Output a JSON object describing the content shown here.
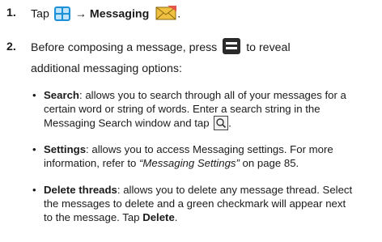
{
  "step1": {
    "number": "1.",
    "text_before": "Tap",
    "arrow": "→",
    "bold": "Messaging",
    "end": "."
  },
  "step2": {
    "number": "2.",
    "text_before": "Before composing a message, press",
    "text_after": "to reveal",
    "line2": "additional messaging options:"
  },
  "bullets": [
    {
      "term": "Search",
      "lines": [
        ": allows you to search through all of your messages for a",
        "certain word or string of words. Enter a search string in the",
        "Messaging Search window and tap"
      ],
      "end": "."
    },
    {
      "term": "Settings",
      "line1": ": allows you to access Messaging settings. For more",
      "line2_before": "information, refer to",
      "line2_italic": "“Messaging Settings”",
      "line2_after": " on page 85."
    },
    {
      "term": "Delete threads",
      "lines": [
        ": allows you to delete any message thread. Select",
        "the messages to delete and a green checkmark will appear next",
        "to the message. Tap"
      ],
      "action": "Delete",
      "end": "."
    }
  ],
  "bullet_char": "•",
  "icons": {
    "apps": "applications-grid-icon",
    "messaging": "messaging-envelope-icon",
    "menu": "menu-key-icon",
    "search": "search-magnifier-icon"
  },
  "colors": {
    "apps_icon": "#1d91d8",
    "envelope": "#f0c040",
    "envelope_accent": "#e2554a"
  }
}
